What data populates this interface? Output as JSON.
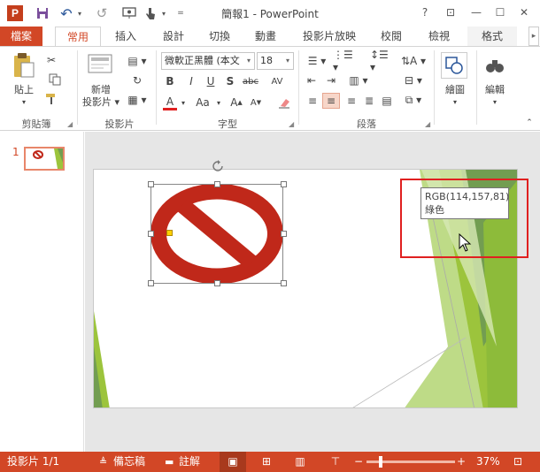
{
  "window": {
    "title": "簡報1 - PowerPoint",
    "app_logo": "P",
    "help": "?",
    "restore_ribbon": "⊡",
    "minimize": "—",
    "maximize": "☐",
    "close": "✕"
  },
  "qat": {
    "save_icon": "floppy-icon",
    "undo": "↶",
    "redo": "↺",
    "customize": "="
  },
  "tabs": [
    "檔案",
    "常用",
    "插入",
    "設計",
    "切換",
    "動畫",
    "投影片放映",
    "校閱",
    "檢視",
    "格式"
  ],
  "ribbon": {
    "clipboard": {
      "label": "剪貼簿",
      "paste": "貼上"
    },
    "slides": {
      "label": "投影片",
      "new_slide_line1": "新增",
      "new_slide_line2": "投影片 ▾"
    },
    "font": {
      "label": "字型",
      "font_name": "微軟正黑體 (本文",
      "font_size": "18",
      "bold": "B",
      "italic": "I",
      "underline": "U",
      "shadow": "S",
      "strike": "abc",
      "spacing": "AV",
      "font_color": "A",
      "change_case": "Aa"
    },
    "paragraph": {
      "label": "段落"
    },
    "drawing": {
      "label": "繪圖"
    },
    "editing": {
      "label": "編輯"
    }
  },
  "slide_pane": {
    "slide_number": "1"
  },
  "tooltip": {
    "line1": "RGB(114,157,81)",
    "line2": "綠色"
  },
  "status": {
    "slide_indicator": "投影片 1/1",
    "notes": "備忘稿",
    "comments": "註解",
    "zoom_minus": "−",
    "zoom_plus": "+",
    "zoom_level": "37%",
    "zoom_slider_level": 0.37
  },
  "colors": {
    "accent": "#d24726",
    "prohibition_red": "#c0281a",
    "green_dark": "#729d51",
    "green_light": "#9cc43c"
  }
}
